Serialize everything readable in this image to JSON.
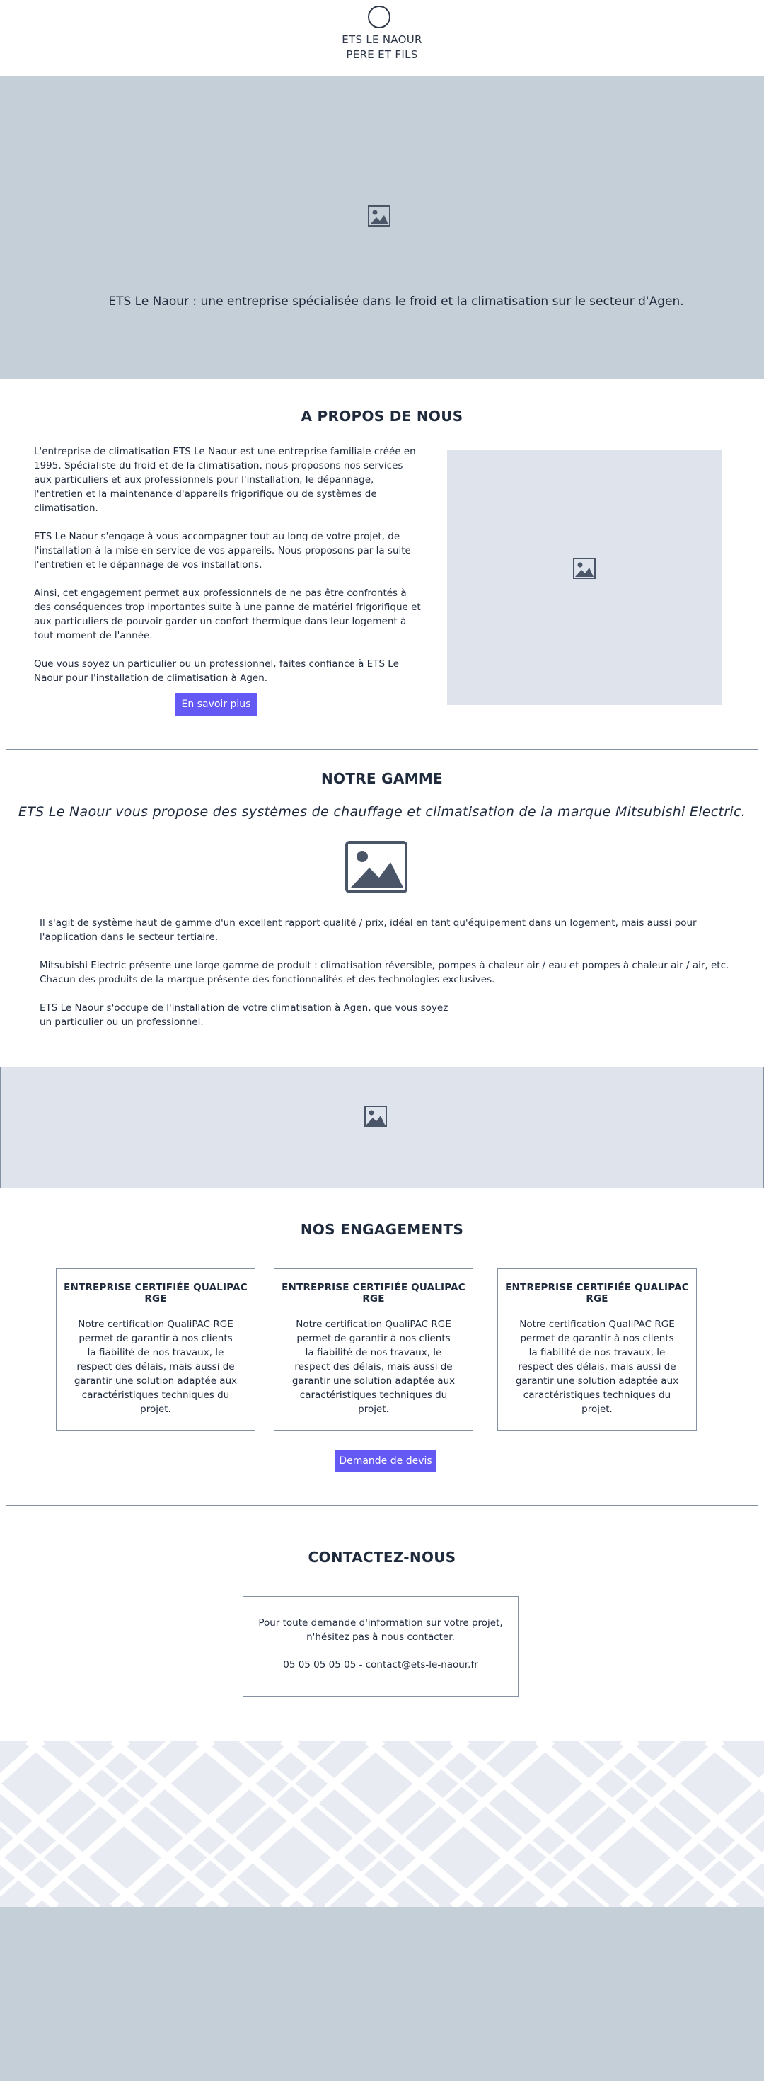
{
  "header": {
    "brand_line1": "ETS LE NAOUR",
    "brand_line2": "PERE ET FILS"
  },
  "hero": {
    "tagline": "ETS Le Naour : une entreprise spécialisée dans le froid et la climatisation sur le secteur d'Agen.",
    "image_icon": "image-icon"
  },
  "about": {
    "title": "A PROPOS DE NOUS",
    "paragraphs": [
      "L'entreprise de climatisation ETS Le Naour est une entreprise familiale créée en 1995. Spécialiste du froid et de la climatisation, nous proposons nos services aux particuliers et aux professionnels pour l'installation, le dépannage, l'entretien et la maintenance d'appareils frigorifique ou de systèmes de climatisation.",
      "ETS Le Naour s'engage à vous accompagner tout au long de votre projet, de l'installation à la mise en service de vos appareils. Nous proposons par la suite l'entretien et le dépannage de vos installations.",
      "Ainsi, cet engagement permet aux professionnels de ne pas être confrontés à des conséquences trop importantes suite à une panne de matériel frigorifique et aux particuliers de pouvoir garder un confort thermique dans leur logement à tout moment de l'année.",
      "Que vous soyez un particulier ou un professionnel, faites confiance à ETS Le Naour pour l'installation de climatisation à Agen."
    ],
    "button_label": "En savoir plus"
  },
  "gamme": {
    "title": "NOTRE GAMME",
    "subtitle": "ETS Le Naour vous propose des systèmes de chauffage et climatisation de la marque Mitsubishi Electric.",
    "paragraphs": [
      "Il s'agit de système haut de gamme d'un excellent rapport qualité / prix, idéal en tant qu'équipement dans un logement, mais aussi pour l'application dans le secteur tertiaire.",
      "Mitsubishi Electric présente une large gamme de produit : climatisation réversible, pompes à chaleur air / eau et pompes à chaleur air / air, etc. Chacun des produits de la marque présente des fonctionnalités et des technologies exclusives.",
      "ETS Le Naour s'occupe de l'installation de votre climatisation à Agen, que vous soyez un particulier ou un professionnel."
    ]
  },
  "engagements": {
    "title": "NOS ENGAGEMENTS",
    "cards": [
      {
        "title": "ENTREPRISE CERTIFIÉE QUALIPAC RGE",
        "text": "Notre certification QualiPAC RGE permet de garantir à nos clients la fiabilité de nos travaux, le respect des délais, mais aussi de garantir une solution adaptée aux caractéristiques techniques du projet."
      },
      {
        "title": "ENTREPRISE CERTIFIÉE QUALIPAC RGE",
        "text": "Notre certification QualiPAC RGE permet de garantir à nos clients la fiabilité de nos travaux, le respect des délais, mais aussi de garantir une solution adaptée aux caractéristiques techniques du projet."
      },
      {
        "title": "ENTREPRISE CERTIFIÉE QUALIPAC RGE",
        "text": "Notre certification QualiPAC RGE permet de garantir à nos clients la fiabilité de nos travaux, le respect des délais, mais aussi de garantir une solution adaptée aux caractéristiques techniques du projet."
      }
    ],
    "button_label": "Demande de devis"
  },
  "contact": {
    "title": "CONTACTEZ-NOUS",
    "line1": "Pour toute demande d'information sur votre projet,",
    "line2": "n'hésitez pas à nous contacter.",
    "phone_email": "05 05 05 05 05 - contact@ets-le-naour.fr"
  },
  "colors": {
    "accent": "#6559f5",
    "hero_bg": "#c4cfd8",
    "placeholder_bg": "#dfe4ec",
    "text": "#1f2a3d",
    "border": "#8491a3"
  }
}
